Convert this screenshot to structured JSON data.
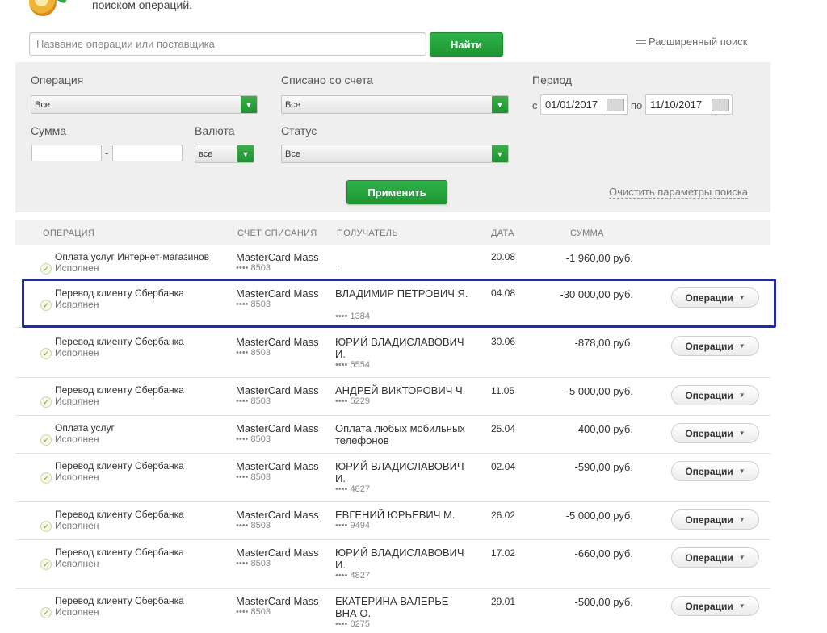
{
  "header": {
    "text": "поиском операций."
  },
  "search": {
    "placeholder": "Название операции или поставщика",
    "button_label": "Найти",
    "advanced_label": "Расширенный поиск"
  },
  "filters": {
    "operation_label": "Операция",
    "operation_value": "Все",
    "account_label": "Списано со счета",
    "account_value": "Все",
    "period_label": "Период",
    "period_from_prefix": "с",
    "period_from": "01/01/2017",
    "period_to_prefix": "по",
    "period_to": "11/10/2017",
    "amount_label": "Сумма",
    "amount_dash": "-",
    "currency_label": "Валюта",
    "currency_value": "все",
    "status_label": "Статус",
    "status_value": "Все",
    "apply_label": "Применить",
    "clear_label": "Очистить параметры поиска"
  },
  "table": {
    "headers": [
      "ОПЕРАЦИЯ",
      "СЧЕТ СПИСАНИЯ",
      "ПОЛУЧАТЕЛЬ",
      "ДАТА",
      "СУММА"
    ],
    "ops_label": "Операции",
    "rows": [
      {
        "op": "Оплата услуг Интернет-магазинов",
        "status": "Исполнен",
        "account": "MasterCard Mass",
        "card": "•••• 8503",
        "recipient": "",
        "recipient_extra": ":",
        "date": "20.08",
        "amount": "-1 960,00 руб."
      },
      {
        "op": "Перевод клиенту Сбербанка",
        "status": "Исполнен",
        "account": "MasterCard Mass",
        "card": "•••• 8503",
        "recipient": "ВЛАДИМИР ПЕТРОВИЧ Я.",
        "recipient_extra": "•••• 1384",
        "date": "04.08",
        "amount": "-30 000,00 руб."
      },
      {
        "op": "Перевод клиенту Сбербанка",
        "status": "Исполнен",
        "account": "MasterCard Mass",
        "card": "•••• 8503",
        "recipient": "ЮРИЙ ВЛАДИСЛАВОВИЧ И.",
        "recipient_extra": "•••• 5554",
        "date": "30.06",
        "amount": "-878,00 руб."
      },
      {
        "op": "Перевод клиенту Сбербанка",
        "status": "Исполнен",
        "account": "MasterCard Mass",
        "card": "•••• 8503",
        "recipient": "АНДРЕЙ ВИКТОРОВИЧ Ч.",
        "recipient_extra": "•••• 5229",
        "date": "11.05",
        "amount": "-5 000,00 руб."
      },
      {
        "op": "Оплата услуг",
        "status": "Исполнен",
        "account": "MasterCard Mass",
        "card": "•••• 8503",
        "recipient": "Оплата любых мобильных телефонов",
        "recipient_extra": "",
        "date": "25.04",
        "amount": "-400,00 руб."
      },
      {
        "op": "Перевод клиенту Сбербанка",
        "status": "Исполнен",
        "account": "MasterCard Mass",
        "card": "•••• 8503",
        "recipient": "ЮРИЙ ВЛАДИСЛАВОВИЧ И.",
        "recipient_extra": "•••• 4827",
        "date": "02.04",
        "amount": "-590,00 руб."
      },
      {
        "op": "Перевод клиенту Сбербанка",
        "status": "Исполнен",
        "account": "MasterCard Mass",
        "card": "•••• 8503",
        "recipient": "ЕВГЕНИЙ ЮРЬЕВИЧ М.",
        "recipient_extra": "•••• 9494",
        "date": "26.02",
        "amount": "-5 000,00 руб."
      },
      {
        "op": "Перевод клиенту Сбербанка",
        "status": "Исполнен",
        "account": "MasterCard Mass",
        "card": "•••• 8503",
        "recipient": "ЮРИЙ ВЛАДИСЛАВОВИЧ И.",
        "recipient_extra": "•••• 4827",
        "date": "17.02",
        "amount": "-660,00 руб."
      },
      {
        "op": "Перевод клиенту Сбербанка",
        "status": "Исполнен",
        "account": "MasterCard Mass",
        "card": "•••• 8503",
        "recipient": "ЕКАТЕРИНА ВАЛЕРЬЕ ВНА О.",
        "recipient_extra": "•••• 0275",
        "date": "29.01",
        "amount": "-500,00 руб."
      }
    ]
  },
  "colors": {
    "accent": "#21a038",
    "highlight": "#1e2aa8",
    "panel": "#efefef"
  }
}
